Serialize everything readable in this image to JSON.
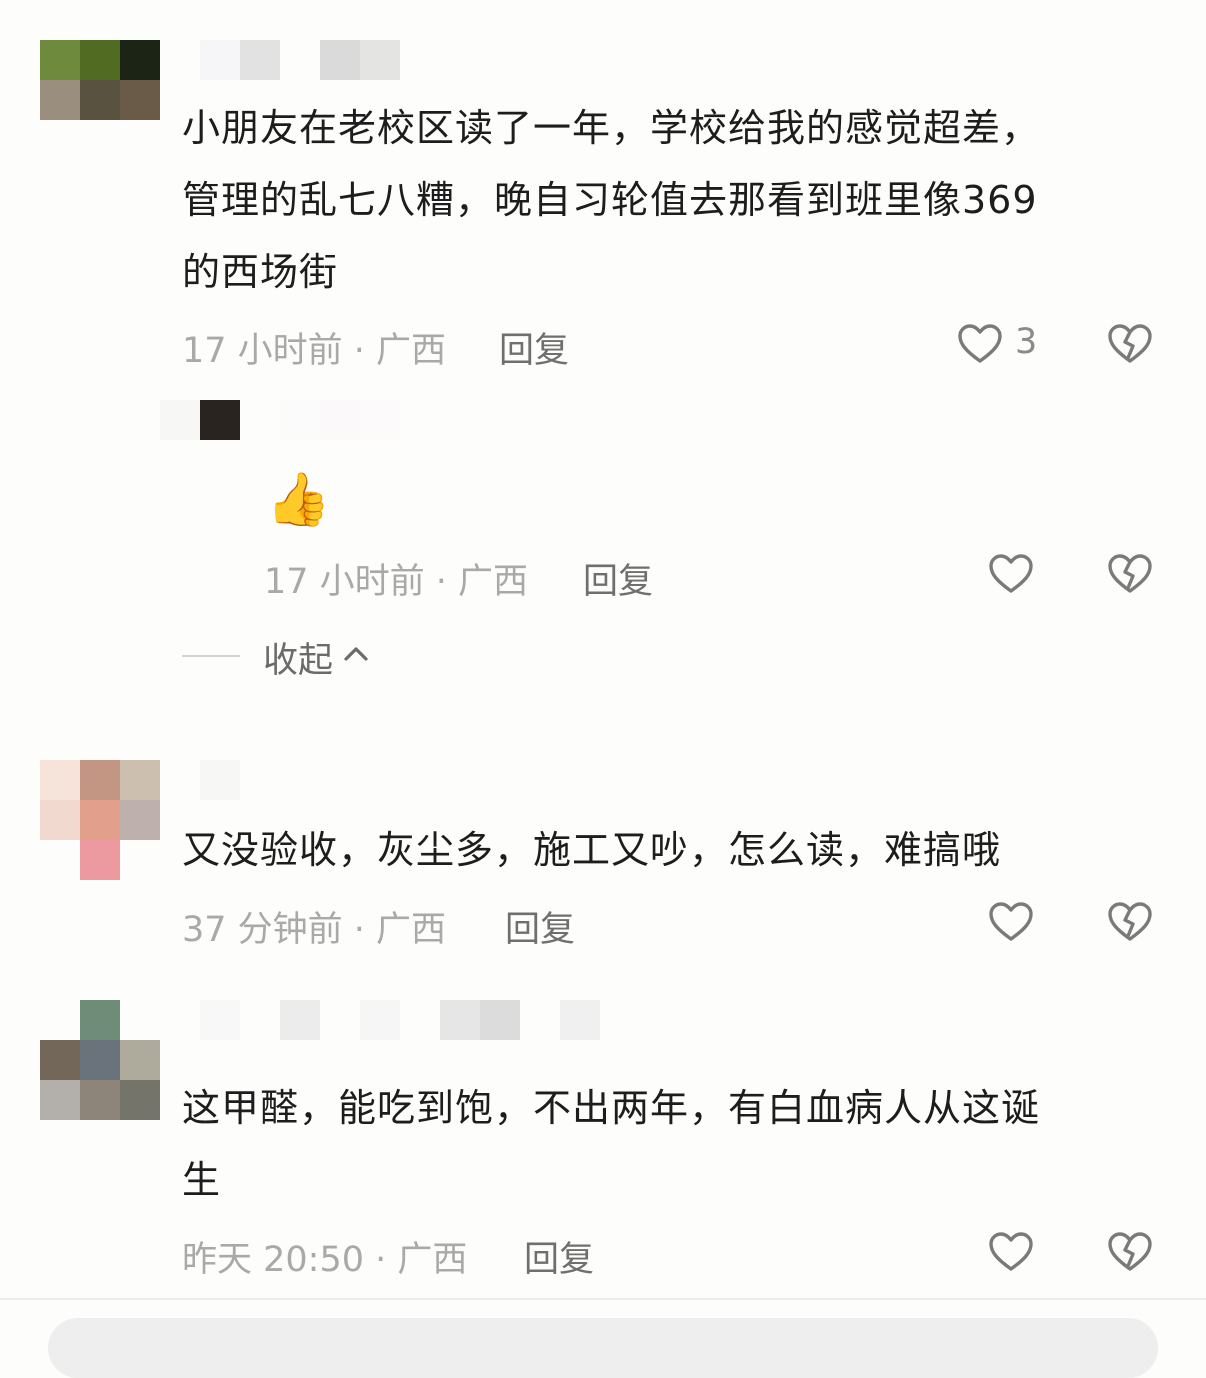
{
  "comments": [
    {
      "text_line1": "小朋友在老校区读了一年，学校给我的感觉超差，",
      "text_line2": "管理的乱七八糟，晚自习轮值去那看到班里像369",
      "text_line3": "的西场街",
      "meta": "17 小时前 · 广西",
      "reply_label": "回复",
      "like_count": "3"
    },
    {
      "emoji": "👍",
      "meta": "17 小时前 · 广西",
      "reply_label": "回复"
    },
    {
      "text_line1": "又没验收，灰尘多，施工又吵，怎么读，难搞哦",
      "meta": "37 分钟前 · 广西",
      "reply_label": "回复"
    },
    {
      "text_line1": "这甲醛，能吃到饱，不出两年，有白血病人从这诞",
      "text_line2": "生",
      "meta": "昨天 20:50 · 广西",
      "reply_label": "回复"
    }
  ],
  "collapse_label": "收起",
  "icons": {
    "like": "heart-outline-icon",
    "dislike": "broken-heart-icon",
    "collapse": "chevron-up-icon"
  },
  "colors": {
    "text": "#1d1d1d",
    "meta": "#a9a9a9",
    "reply": "#6f6f6f",
    "icon": "#7a7a7a",
    "background": "#fdfdfb"
  }
}
